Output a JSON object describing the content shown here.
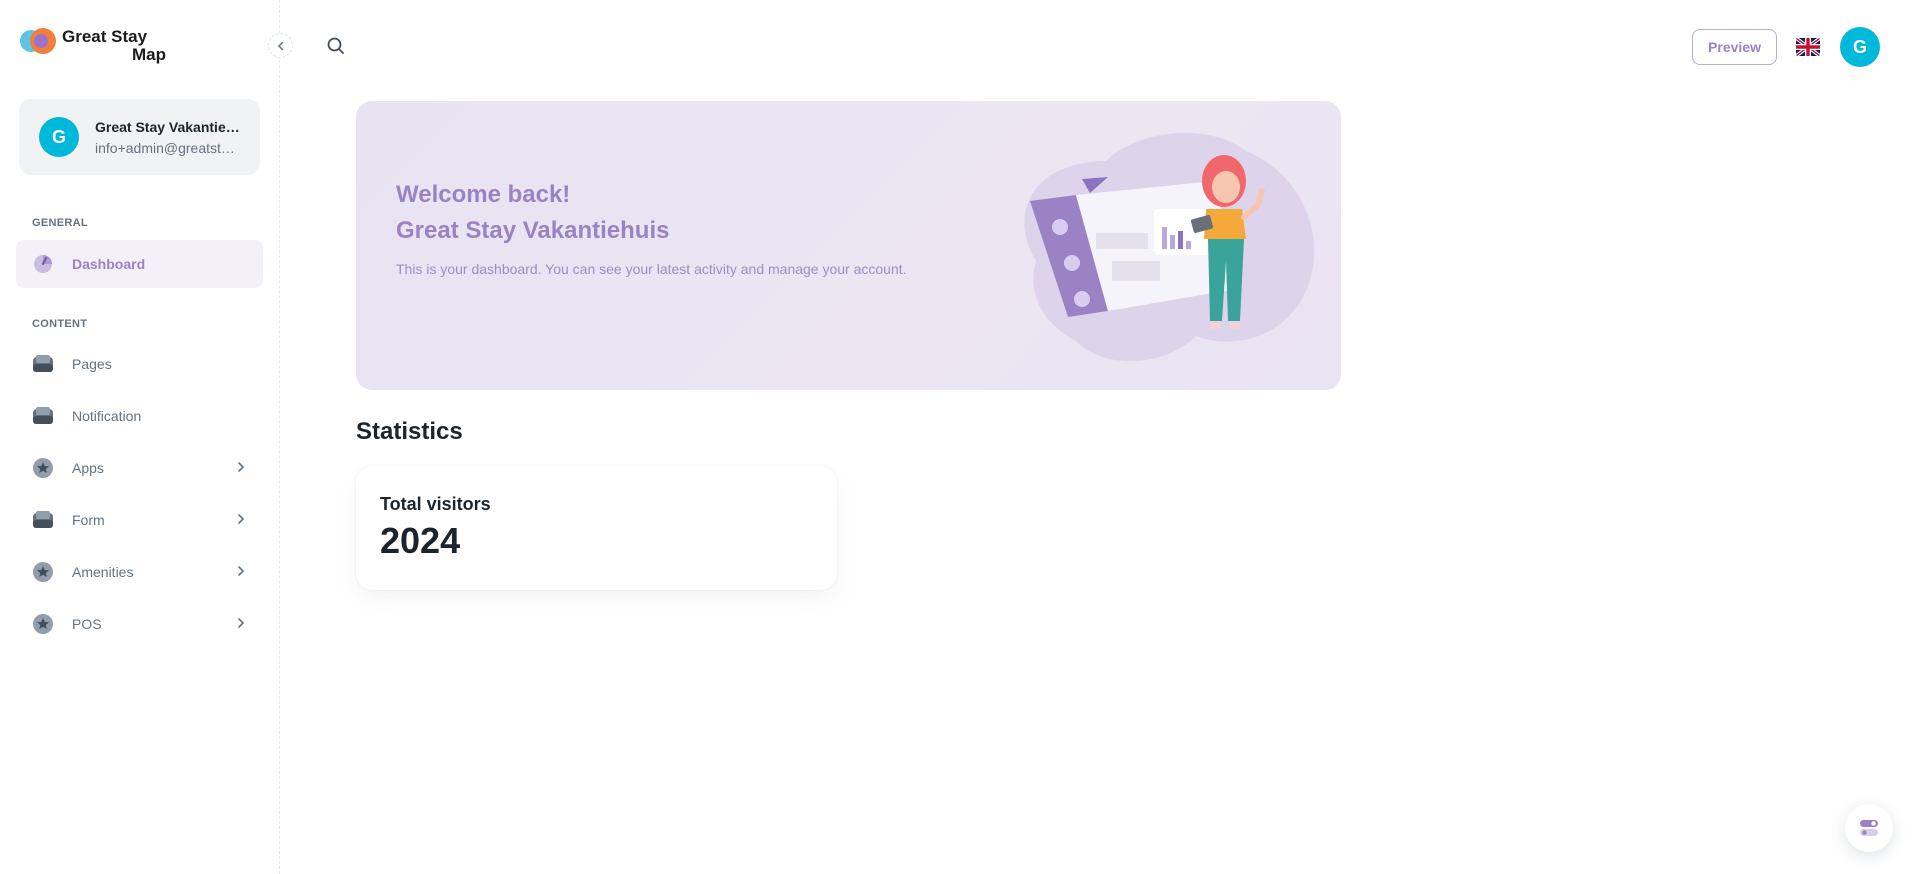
{
  "app": {
    "logo_text_line1": "Great Stay",
    "logo_text_line2": "Map"
  },
  "account": {
    "avatar_letter": "G",
    "name": "Great Stay Vakantiehuis",
    "email": "info+admin@greatstaymap.com"
  },
  "sidebar": {
    "general_label": "GENERAL",
    "content_label": "CONTENT",
    "general_items": [
      {
        "label": "Dashboard",
        "icon": "dashboard-icon",
        "active": true
      }
    ],
    "content_items": [
      {
        "label": "Pages",
        "icon": "inbox-icon",
        "has_children": false
      },
      {
        "label": "Notification",
        "icon": "inbox-icon",
        "has_children": false
      },
      {
        "label": "Apps",
        "icon": "star-icon",
        "has_children": true
      },
      {
        "label": "Form",
        "icon": "inbox-icon",
        "has_children": true
      },
      {
        "label": "Amenities",
        "icon": "star-icon",
        "has_children": true
      },
      {
        "label": "POS",
        "icon": "star-icon",
        "has_children": true
      }
    ]
  },
  "header": {
    "preview_label": "Preview",
    "language": "en-GB",
    "avatar_letter": "G"
  },
  "welcome": {
    "line1": "Welcome back!",
    "line2": "Great Stay Vakantiehuis",
    "description": "This is your dashboard. You can see your latest activity and manage your account."
  },
  "statistics": {
    "title": "Statistics",
    "cards": [
      {
        "label": "Total visitors",
        "value": "2024"
      }
    ]
  },
  "colors": {
    "accent": "#9b82c4",
    "avatar": "#00b8d9",
    "banner_bg": "#e8e4f1"
  }
}
